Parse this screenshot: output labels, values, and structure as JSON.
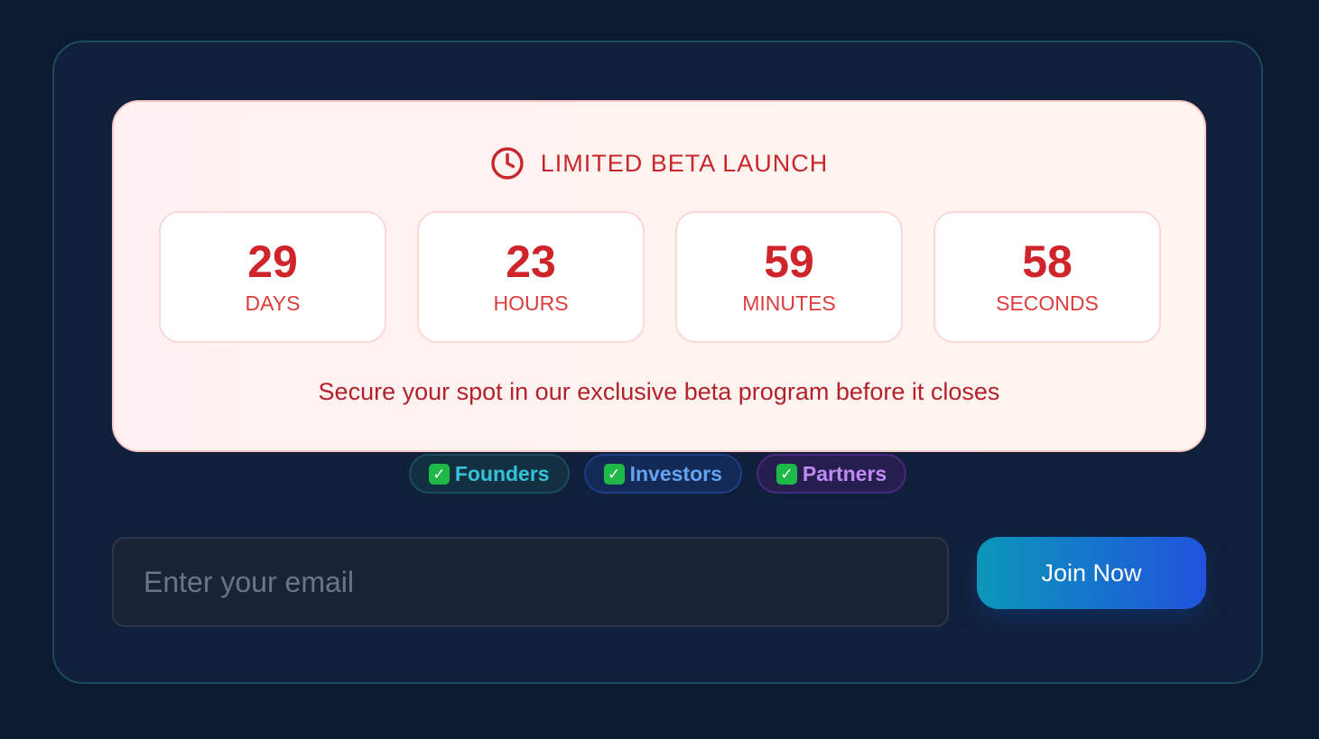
{
  "countdown": {
    "icon": "clock-icon",
    "title": "LIMITED BETA LAUNCH",
    "units": [
      {
        "value": "29",
        "label": "DAYS"
      },
      {
        "value": "23",
        "label": "HOURS"
      },
      {
        "value": "59",
        "label": "MINUTES"
      },
      {
        "value": "58",
        "label": "SECONDS"
      }
    ],
    "subtitle": "Secure your spot in our exclusive beta program before it closes"
  },
  "badges": [
    {
      "icon": "check-mark-icon",
      "label": "Founders",
      "color": "#35c2d8"
    },
    {
      "icon": "check-mark-icon",
      "label": "Investors",
      "color": "#63a3f2"
    },
    {
      "icon": "check-mark-icon",
      "label": "Partners",
      "color": "#c08af6"
    }
  ],
  "signup": {
    "email_placeholder": "Enter your email",
    "email_value": "",
    "button_label": "Join Now"
  },
  "colors": {
    "page_background": "#0c1a2f",
    "card_background": "#11203a",
    "accent_red": "#d0242b",
    "button_gradient_start": "#0b97b9",
    "button_gradient_end": "#2152dd"
  }
}
